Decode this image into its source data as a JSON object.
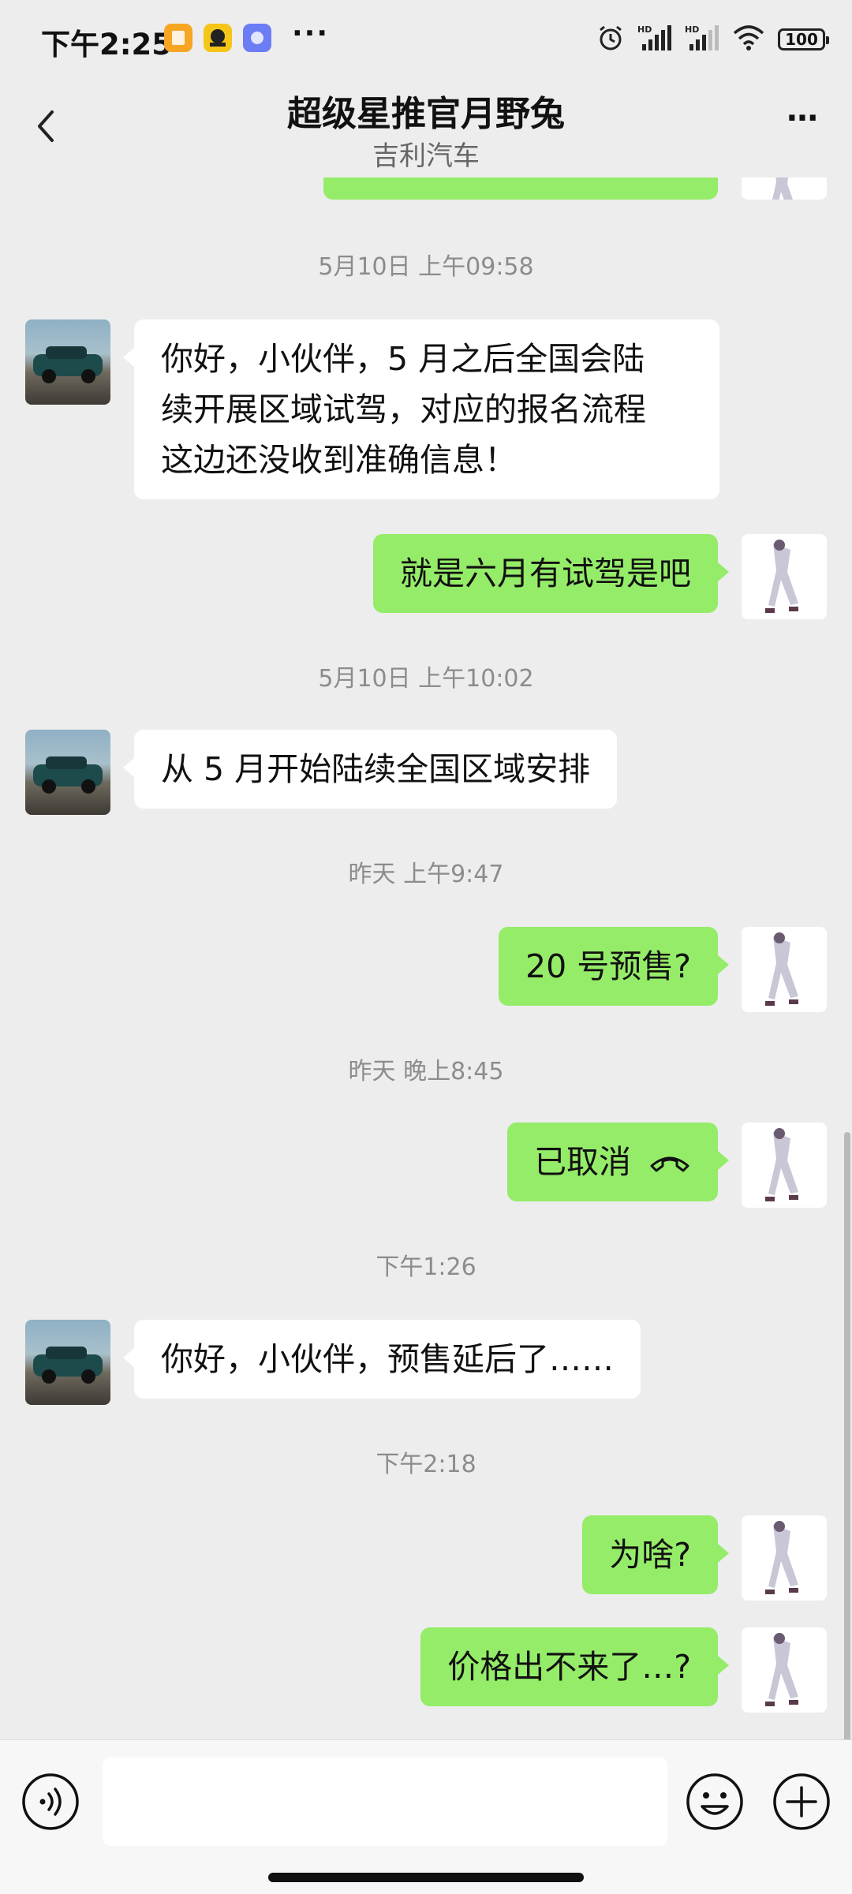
{
  "status_bar": {
    "time": "下午2:25",
    "more": "···",
    "battery": "100",
    "icons": [
      "orange-app-icon",
      "taxi-app-icon",
      "blue-app-icon",
      "alarm-icon",
      "hd-signal-icon",
      "hd-signal-icon",
      "wifi-icon",
      "battery-icon"
    ]
  },
  "header": {
    "title": "超级星推官月野兔",
    "subtitle": "吉利汽车",
    "back_icon": "chevron-left-icon",
    "more_icon": "more-dots-icon",
    "more_label": "···"
  },
  "messages": [
    {
      "type": "timestamp",
      "text": "5月10日 上午09:58"
    },
    {
      "side": "left",
      "text_lines": [
        "你好，小伙伴，5 月之后全国会陆",
        "续开展区域试驾，对应的报名流程",
        "这边还没收到准确信息！"
      ]
    },
    {
      "side": "right",
      "text": "就是六月有试驾是吧"
    },
    {
      "type": "timestamp",
      "text": "5月10日 上午10:02"
    },
    {
      "side": "left",
      "text": "从 5 月开始陆续全国区域安排"
    },
    {
      "type": "timestamp",
      "text": "昨天 上午9:47"
    },
    {
      "side": "right",
      "text": "20 号预售?"
    },
    {
      "type": "timestamp",
      "text": "昨天 晚上8:45"
    },
    {
      "side": "right",
      "text": "已取消",
      "icon": "hang-up-icon"
    },
    {
      "type": "timestamp",
      "text": "下午1:26"
    },
    {
      "side": "left",
      "text": "你好，小伙伴，预售延后了……"
    },
    {
      "type": "timestamp",
      "text": "下午2:18"
    },
    {
      "side": "right",
      "text": "为啥?"
    },
    {
      "side": "right",
      "text": "价格出不来了…?"
    }
  ],
  "input_bar": {
    "voice_icon": "voice-icon",
    "input_value": "",
    "emoji_icon": "emoji-icon",
    "plus_icon": "plus-icon"
  },
  "colors": {
    "background": "#ededed",
    "bubble_self": "#95ec69",
    "bubble_other": "#ffffff"
  }
}
